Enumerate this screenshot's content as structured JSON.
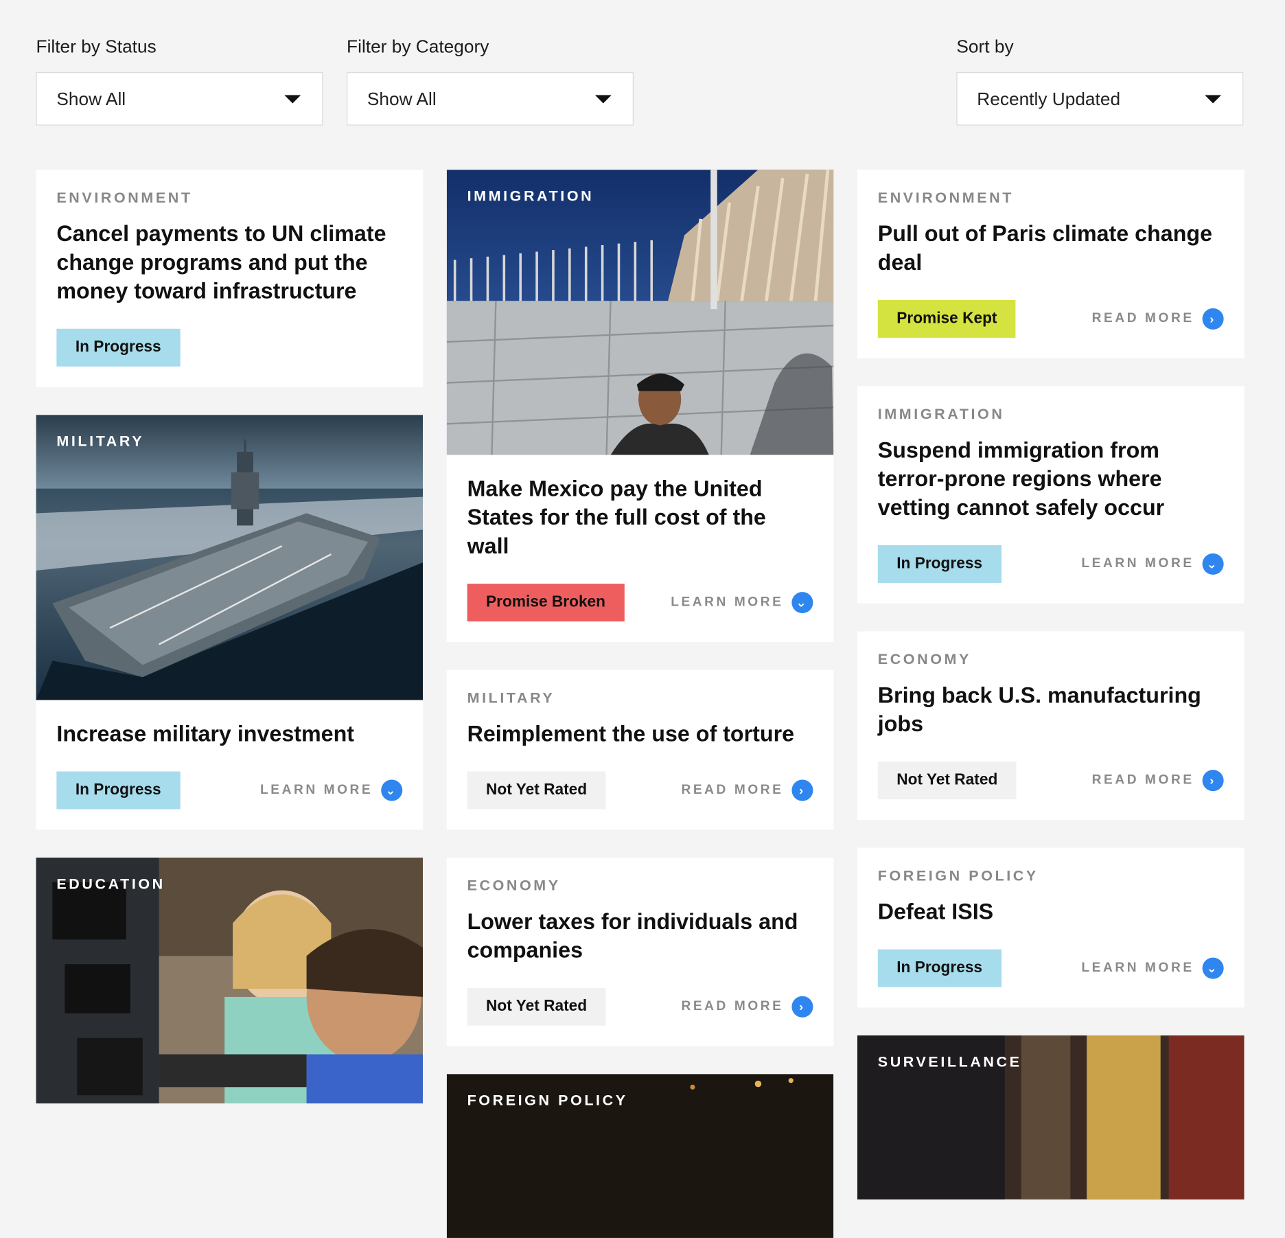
{
  "filters": {
    "status": {
      "label": "Filter by Status",
      "value": "Show All"
    },
    "category": {
      "label": "Filter by Category",
      "value": "Show All"
    },
    "sort": {
      "label": "Sort by",
      "value": "Recently Updated"
    }
  },
  "columns": [
    [
      {
        "category": "ENVIRONMENT",
        "title": "Cancel payments to UN climate change programs and put the money toward infrastructure",
        "status": "In Progress"
      },
      {
        "category": "MILITARY",
        "title": "Increase military investment",
        "status": "In Progress",
        "more": "LEARN MORE",
        "image": "aircraft-carrier"
      },
      {
        "category": "EDUCATION",
        "image": "classroom"
      }
    ],
    [
      {
        "category": "IMMIGRATION",
        "title": "Make Mexico pay the United States for the full cost of the wall",
        "status": "Promise Broken",
        "more": "LEARN MORE",
        "image": "border-wall"
      },
      {
        "category": "MILITARY",
        "title": "Reimplement the use of torture",
        "status": "Not Yet Rated",
        "more": "READ MORE"
      },
      {
        "category": "ECONOMY",
        "title": "Lower taxes for individuals and companies",
        "status": "Not Yet Rated",
        "more": "READ MORE"
      },
      {
        "category": "FOREIGN POLICY",
        "image": "dark-photo"
      }
    ],
    [
      {
        "category": "ENVIRONMENT",
        "title": "Pull out of Paris climate change deal",
        "status": "Promise Kept",
        "more": "READ MORE"
      },
      {
        "category": "IMMIGRATION",
        "title": "Suspend immigration from terror-prone regions where vetting cannot safely occur",
        "status": "In Progress",
        "more": "LEARN MORE"
      },
      {
        "category": "ECONOMY",
        "title": "Bring back U.S. manufacturing jobs",
        "status": "Not Yet Rated",
        "more": "READ MORE"
      },
      {
        "category": "FOREIGN POLICY",
        "title": "Defeat ISIS",
        "status": "In Progress",
        "more": "LEARN MORE"
      },
      {
        "category": "SURVEILLANCE",
        "image": "city-photo"
      }
    ]
  ],
  "colors": {
    "in_progress": "#a6dcec",
    "kept": "#d4e33f",
    "broken": "#ee5e5e",
    "not_rated": "#f1f1f1",
    "accent": "#2f86ee"
  },
  "icons": {
    "dropdown": "caret-down-icon",
    "read_more": "chevron-right-circle-icon",
    "learn_more": "chevron-down-circle-icon"
  }
}
